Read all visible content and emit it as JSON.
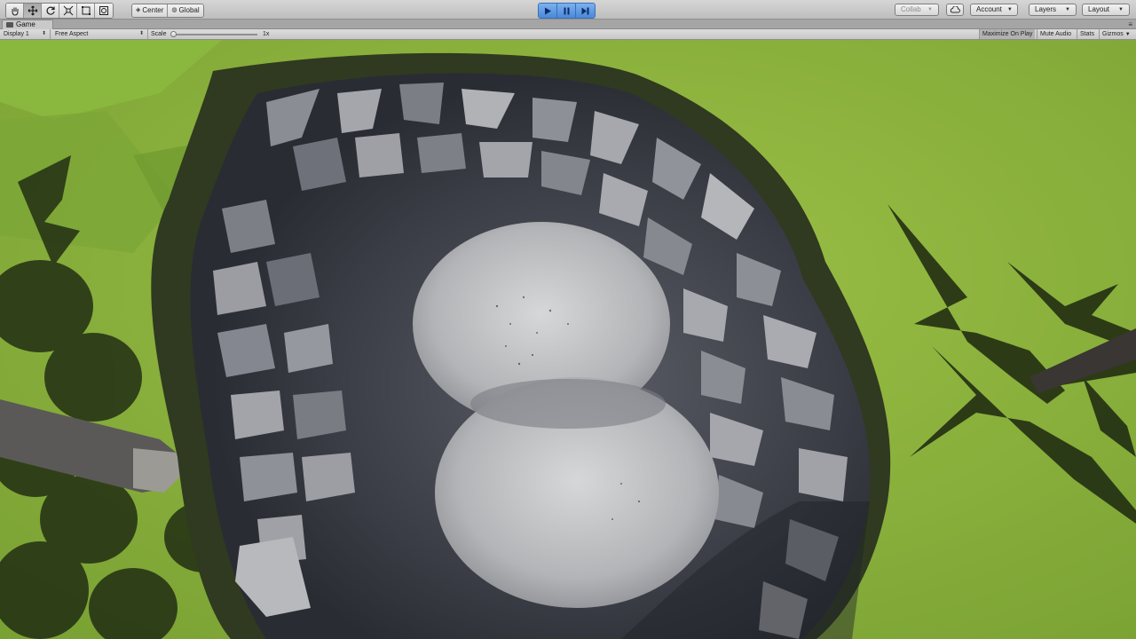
{
  "toolbar": {
    "transform_tools": [
      {
        "icon": "hand-icon",
        "active": false
      },
      {
        "icon": "move-icon",
        "active": true
      },
      {
        "icon": "rotate-icon",
        "active": false
      },
      {
        "icon": "scale-icon",
        "active": false
      },
      {
        "icon": "rect-icon",
        "active": false
      },
      {
        "icon": "transform-icon",
        "active": false
      }
    ],
    "pivot_label": "Center",
    "rotation_label": "Global",
    "play_controls": [
      {
        "icon": "play-icon",
        "active": true
      },
      {
        "icon": "pause-icon",
        "active": true
      },
      {
        "icon": "step-icon",
        "active": true
      }
    ],
    "collab_label": "Collab",
    "cloud_icon": "cloud-icon",
    "account_label": "Account",
    "layers_label": "Layers",
    "layout_label": "Layout"
  },
  "tab": {
    "title": "Game",
    "icon": "game-controller-icon",
    "menu_icon": "tab-menu-icon"
  },
  "game_bar": {
    "display_label": "Display 1",
    "aspect_label": "Free Aspect",
    "scale_label": "Scale",
    "scale_value_label": "1x",
    "scale_value": 1,
    "maximize_label": "Maximize On Play",
    "mute_label": "Mute Audio",
    "stats_label": "Stats",
    "gizmos_label": "Gizmos"
  },
  "colors": {
    "play_active": "#4b88d8",
    "grass": "#84ad3a",
    "rock_dark": "#3d3f48",
    "rock_light": "#c8c9cb"
  }
}
